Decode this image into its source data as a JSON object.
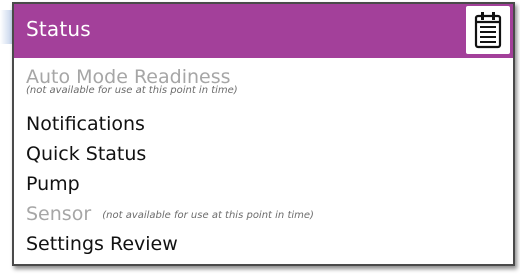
{
  "header": {
    "title": "Status",
    "icon": "notepad-icon",
    "color": "#a3409a"
  },
  "menu": {
    "items": [
      {
        "label": "Auto Mode Readiness",
        "note": "(not available for use at this point in time)",
        "enabled": false
      },
      {
        "label": "Notifications",
        "enabled": true
      },
      {
        "label": "Quick Status",
        "enabled": true
      },
      {
        "label": "Pump",
        "enabled": true
      },
      {
        "label": "Sensor",
        "note": "(not available for use at this point in time)",
        "enabled": false
      },
      {
        "label": "Settings Review",
        "enabled": true
      }
    ]
  }
}
